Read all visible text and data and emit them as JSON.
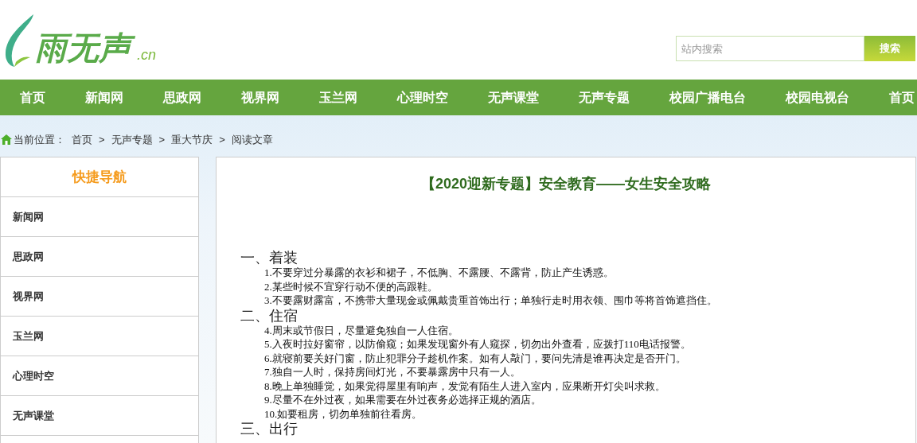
{
  "logo": {
    "name": "雨无声",
    "suffix": ".cn"
  },
  "search": {
    "placeholder": "站内搜索",
    "button": "搜索"
  },
  "nav": [
    "首页",
    "新闻网",
    "思政网",
    "视界网",
    "玉兰网",
    "心理时空",
    "无声课堂",
    "无声专题",
    "校园广播电台",
    "校园电视台",
    "首页"
  ],
  "breadcrumb": {
    "label": "当前位置：",
    "items": [
      "首页",
      "无声专题",
      "重大节庆",
      "阅读文章"
    ],
    "separator": ">"
  },
  "sidebar": {
    "title": "快捷导航",
    "items": [
      "新闻网",
      "思政网",
      "视界网",
      "玉兰网",
      "心理时空",
      "无声课堂"
    ]
  },
  "article": {
    "title": "【2020迎新专题】安全教育——女生安全攻略",
    "sections": [
      {
        "heading": "一、着装",
        "items": [
          "1.不要穿过分暴露的衣衫和裙子，不低胸、不露腰、不露背，防止产生诱惑。",
          "2.某些时候不宜穿行动不便的高跟鞋。",
          "3.不要露财露富，不携带大量现金或佩戴贵重首饰出行；单独行走时用衣领、围巾等将首饰遮挡住。"
        ]
      },
      {
        "heading": "二、住宿",
        "items": [
          "4.周末或节假日，尽量避免独自一人住宿。",
          "5.入夜时拉好窗帘，以防偷窥；如果发现窗外有人窥探，切勿出外查看，应拨打110电话报警。",
          "6.就寝前要关好门窗，防止犯罪分子趁机作案。如有人敲门，要问先清是谁再决定是否开门。",
          "7.独自一人时，保持房间灯光，不要暴露房中只有一人。",
          "8.晚上单独睡觉，如果觉得屋里有响声，发觉有陌生人进入室内，应果断开灯尖叫求救。",
          "9.尽量不在外过夜，如果需要在外过夜务必选择正规的酒店。",
          "10.如要租房，切勿单独前往看房。"
        ]
      },
      {
        "heading": "三、出行"
      }
    ]
  }
}
